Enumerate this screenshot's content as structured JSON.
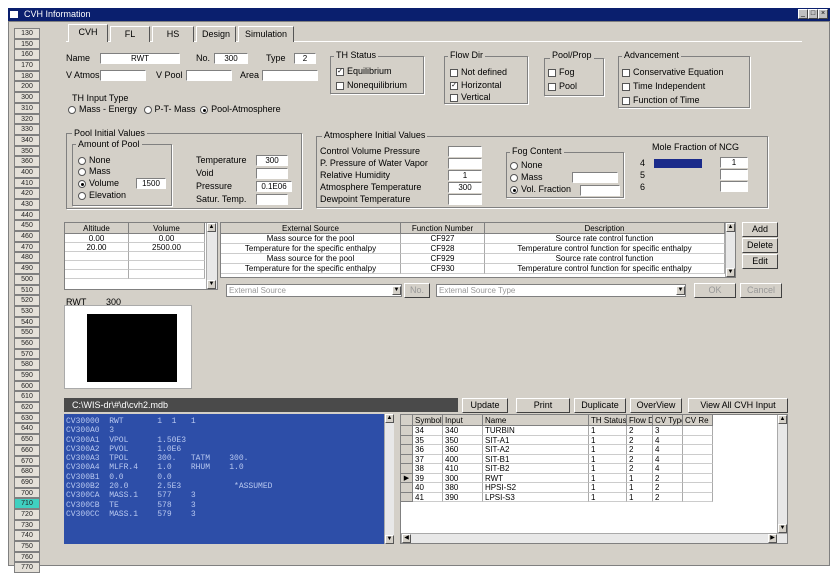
{
  "window": {
    "title": "CVH Information",
    "controls": [
      "_",
      "□",
      "×"
    ]
  },
  "sidebar": {
    "items": [
      "130",
      "150",
      "160",
      "170",
      "180",
      "200",
      "300",
      "310",
      "320",
      "330",
      "340",
      "350",
      "360",
      "400",
      "410",
      "420",
      "430",
      "440",
      "450",
      "460",
      "470",
      "480",
      "490",
      "500",
      "510",
      "520",
      "530",
      "540",
      "550",
      "560",
      "570",
      "580",
      "590",
      "600",
      "610",
      "620",
      "630",
      "640",
      "650",
      "660",
      "670",
      "680",
      "690",
      "700",
      "710",
      "720",
      "730",
      "740",
      "750",
      "760",
      "770"
    ],
    "selected_index": 44
  },
  "tabs": [
    {
      "label": "CVH",
      "active": true
    },
    {
      "label": "FL",
      "active": false
    },
    {
      "label": "HS",
      "active": false
    },
    {
      "label": "Design",
      "active": false
    },
    {
      "label": "Simulation",
      "active": false
    }
  ],
  "cvh": {
    "name_label": "Name",
    "name_value": "RWT",
    "no_label": "No.",
    "no_value": "300",
    "type_label": "Type",
    "type_value": "2",
    "vatmos_label": "V Atmos",
    "vatmos_value": "",
    "vpool_label": "V Pool",
    "vpool_value": "",
    "area_label": "Area",
    "area_value": ""
  },
  "th_status": {
    "title": "TH Status",
    "equilibrium": "Equilibrium",
    "nonequilibrium": "Nonequilibrium",
    "equilibrium_checked": true,
    "nonequilibrium_checked": false
  },
  "flow_dir": {
    "title": "Flow Dir",
    "options": [
      "Not defined",
      "Horizontal",
      "Vertical"
    ],
    "checked": [
      false,
      true,
      false
    ]
  },
  "pool_prop": {
    "title": "Pool/Prop",
    "options": [
      "Fog",
      "Pool"
    ]
  },
  "advancement": {
    "title": "Advancement",
    "options": [
      "Conservative Equation",
      "Time Independent",
      "Function of Time"
    ]
  },
  "th_input": {
    "title": "TH Input Type",
    "options": [
      "Mass - Energy",
      "P-T- Mass",
      "Pool-Atmosphere"
    ],
    "selected": 2
  },
  "pool_init": {
    "title": "Pool Initial Values",
    "amount_title": "Amount of Pool",
    "options": [
      "None",
      "Mass",
      "Volume",
      "Elevation"
    ],
    "selected": 2,
    "volume_value": "1500",
    "temperature_label": "Temperature",
    "temperature_value": "300",
    "void_label": "Void",
    "void_value": "",
    "pressure_label": "Pressure",
    "pressure_value": "0.1E06",
    "satur_label": "Satur. Temp.",
    "satur_value": ""
  },
  "atmos_init": {
    "title": "Atmosphere Initial Values",
    "cv_pressure_label": "Control Volume Pressure",
    "cv_pressure_value": "",
    "water_vapor_label": "P. Pressure of Water Vapor",
    "water_vapor_value": "",
    "humidity_label": "Relative Humidity",
    "humidity_value": "1",
    "atm_temp_label": "Atmosphere Temperature",
    "atm_temp_value": "300",
    "dewpoint_label": "Dewpoint Temperature",
    "dewpoint_value": ""
  },
  "fog_content": {
    "title": "Fog Content",
    "options": [
      "None",
      "Mass",
      "Vol. Fraction"
    ],
    "selected": 2
  },
  "ncg": {
    "title": "Mole Fraction of NCG",
    "rows": [
      "4",
      "5",
      "6"
    ],
    "values": [
      "1",
      "",
      ""
    ],
    "swatch_color": "#1a2a8a"
  },
  "alt_table": {
    "headers": [
      "Altitude",
      "Volume"
    ],
    "rows": [
      [
        "0.00",
        "0.00"
      ],
      [
        "20.00",
        "2500.00"
      ]
    ]
  },
  "ext_table": {
    "headers": [
      "External Source",
      "Function Number",
      "Description"
    ],
    "rows": [
      [
        "Mass source for the pool",
        "CF927",
        "Source rate control function"
      ],
      [
        "Temperature for the specific enthalpy",
        "CF928",
        "Temperature control function for specific enthalpy"
      ],
      [
        "Mass source for the pool",
        "CF929",
        "Source rate control function"
      ],
      [
        "Temperature for the specific enthalpy",
        "CF930",
        "Temperature control function for specific enthalpy"
      ]
    ]
  },
  "side_buttons": [
    "Add",
    "Delete",
    "Edit"
  ],
  "ext_controls": {
    "source_placeholder": "External Source",
    "no_label": "No.",
    "type_placeholder": "External Source Type",
    "ok": "OK",
    "cancel": "Cancel"
  },
  "preview": {
    "label": "RWT",
    "number": "300"
  },
  "file_path": "C:\\WIS-dr\\#\\d\\cvh2.mdb",
  "action_buttons": [
    "Update",
    "Print",
    "Duplicate",
    "OverView",
    "View All CVH Input"
  ],
  "listing": [
    "CV30000  RWT       1  1   1",
    "CV300A0  3",
    "CV300A1  VPOL      1.50E3",
    "CV300A2  PVOL      1.0E6",
    "CV300A3  TPOL      300.   TATM    300.",
    "CV300A4  MLFR.4    1.0    RHUM    1.0",
    "CV300B1  0.0       0.0",
    "CV300B2  20.0      2.5E3           *ASSUMED",
    "CV300CA  MASS.1    577    3",
    "CV300CB  TE        578    3",
    "CV300CC  MASS.1    579    3"
  ],
  "cvh_list": {
    "headers": [
      "Symbol",
      "Input",
      "Name",
      "TH Status",
      "Flow Dir",
      "CV Type",
      "CV Re"
    ],
    "rows": [
      [
        "34",
        "340",
        "TURBIN",
        "1",
        "2",
        "3",
        ""
      ],
      [
        "35",
        "350",
        "SIT-A1",
        "1",
        "2",
        "4",
        ""
      ],
      [
        "36",
        "360",
        "SIT-A2",
        "1",
        "2",
        "4",
        ""
      ],
      [
        "37",
        "400",
        "SIT-B1",
        "1",
        "2",
        "4",
        ""
      ],
      [
        "38",
        "410",
        "SIT-B2",
        "1",
        "2",
        "4",
        ""
      ],
      [
        "39",
        "300",
        "RWT",
        "1",
        "1",
        "2",
        ""
      ],
      [
        "40",
        "380",
        "HPSI-S2",
        "1",
        "1",
        "2",
        ""
      ],
      [
        "41",
        "390",
        "LPSI-S3",
        "1",
        "1",
        "2",
        ""
      ]
    ],
    "current_row": 5
  }
}
